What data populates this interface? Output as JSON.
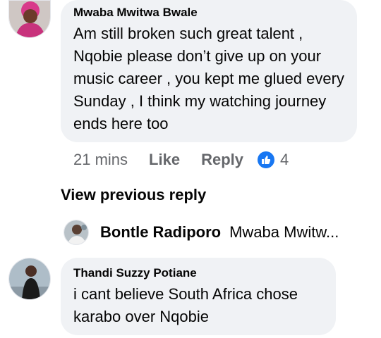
{
  "comments": [
    {
      "author": "Mwaba Mwitwa Bwale",
      "text": "Am still broken such great talent , Nqobie please don’t give up on your music career , you kept me glued every Sunday , I think my watching journey ends here too",
      "time": "21 mins",
      "like_label": "Like",
      "reply_label": "Reply",
      "reaction_icon": "thumbs-up-icon",
      "reaction_count": "4"
    },
    {
      "author": "Thandi Suzzy Potiane",
      "text": "i cant believe South Africa chose karabo over Nqobie"
    }
  ],
  "view_previous_reply": "View previous reply",
  "collapsed_reply": {
    "author": "Bontle Radiporo",
    "preview": "Mwaba Mwitw..."
  },
  "colors": {
    "bubble_bg": "#f0f2f5",
    "meta_text": "#65676b",
    "like_blue": "#1877f2"
  }
}
